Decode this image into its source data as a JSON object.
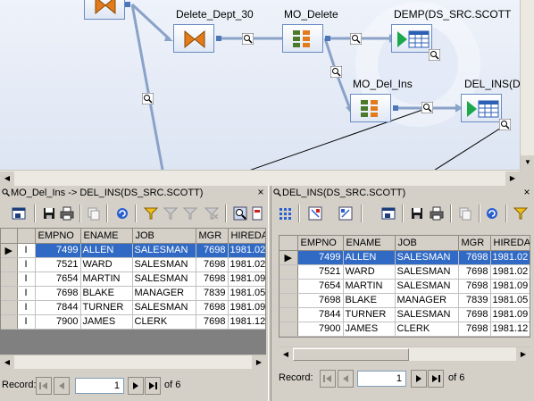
{
  "canvas": {
    "nodes": {
      "delete_dept_30": "Delete_Dept_30",
      "mo_delete": "MO_Delete",
      "demp": "DEMP(DS_SRC.SCOTT",
      "mo_del_ins": "MO_Del_Ins",
      "del_ins": "DEL_INS(D"
    }
  },
  "left_panel": {
    "title": "MO_Del_Ins -> DEL_INS(DS_SRC.SCOTT)",
    "close": "×",
    "columns": [
      "EMPNO",
      "ENAME",
      "JOB",
      "MGR",
      "HIREDA"
    ],
    "rows": [
      {
        "op": "I",
        "empno": "7499",
        "ename": "ALLEN",
        "job": "SALESMAN",
        "mgr": "7698",
        "hire": "1981.02"
      },
      {
        "op": "I",
        "empno": "7521",
        "ename": "WARD",
        "job": "SALESMAN",
        "mgr": "7698",
        "hire": "1981.02"
      },
      {
        "op": "I",
        "empno": "7654",
        "ename": "MARTIN",
        "job": "SALESMAN",
        "mgr": "7698",
        "hire": "1981.09"
      },
      {
        "op": "I",
        "empno": "7698",
        "ename": "BLAKE",
        "job": "MANAGER",
        "mgr": "7839",
        "hire": "1981.05"
      },
      {
        "op": "I",
        "empno": "7844",
        "ename": "TURNER",
        "job": "SALESMAN",
        "mgr": "7698",
        "hire": "1981.09"
      },
      {
        "op": "I",
        "empno": "7900",
        "ename": "JAMES",
        "job": "CLERK",
        "mgr": "7698",
        "hire": "1981.12"
      }
    ],
    "record_label": "Record:",
    "record_value": "1",
    "record_of": "of 6"
  },
  "right_panel": {
    "title": "DEL_INS(DS_SRC.SCOTT)",
    "close": "×",
    "columns": [
      "EMPNO",
      "ENAME",
      "JOB",
      "MGR",
      "HIREDA"
    ],
    "rows": [
      {
        "empno": "7499",
        "ename": "ALLEN",
        "job": "SALESMAN",
        "mgr": "7698",
        "hire": "1981.02"
      },
      {
        "empno": "7521",
        "ename": "WARD",
        "job": "SALESMAN",
        "mgr": "7698",
        "hire": "1981.02"
      },
      {
        "empno": "7654",
        "ename": "MARTIN",
        "job": "SALESMAN",
        "mgr": "7698",
        "hire": "1981.09"
      },
      {
        "empno": "7698",
        "ename": "BLAKE",
        "job": "MANAGER",
        "mgr": "7839",
        "hire": "1981.05"
      },
      {
        "empno": "7844",
        "ename": "TURNER",
        "job": "SALESMAN",
        "mgr": "7698",
        "hire": "1981.09"
      },
      {
        "empno": "7900",
        "ename": "JAMES",
        "job": "CLERK",
        "mgr": "7698",
        "hire": "1981.12"
      }
    ],
    "record_label": "Record:",
    "record_value": "1",
    "record_of": "of 6"
  },
  "colors": {
    "selection": "#316ac5",
    "canvas_bg": "#e6ecf7",
    "node_border": "#6a8cc0",
    "link": "#8aa2c8"
  },
  "icons": {
    "toolbar_left": [
      "grid-view-icon",
      "save-icon",
      "print-icon",
      "copy-icon",
      "refresh-icon",
      "filter-icon",
      "filter-add-icon",
      "filter-remove-icon",
      "filter-clear-icon",
      "find-icon",
      "export-icon"
    ],
    "toolbar_right": [
      "grid-dots-icon",
      "sort-asc-icon",
      "sort-desc-icon",
      "grid-view-icon",
      "save-icon",
      "print-icon",
      "copy-icon",
      "refresh-icon",
      "filter-icon"
    ]
  }
}
